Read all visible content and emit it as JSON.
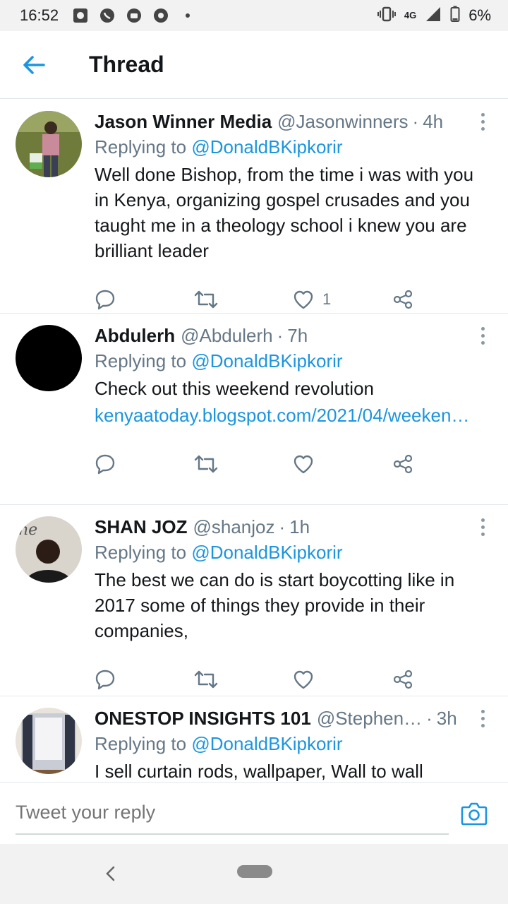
{
  "status_bar": {
    "time": "16:52",
    "network": "4G",
    "battery": "6%"
  },
  "header": {
    "title": "Thread"
  },
  "tweets": [
    {
      "name": "Jason Winner Media",
      "handle": "@Jasonwinners",
      "time": "4h",
      "replying_prefix": "Replying to ",
      "replying_to": "@DonaldBKipkorir",
      "text": "Well done Bishop, from the time i was with you in Kenya, organizing gospel crusades and you taught me in a theology school i knew you are brilliant leader",
      "link": "",
      "likes": "1"
    },
    {
      "name": "Abdulerh",
      "handle": "@Abdulerh",
      "time": "7h",
      "replying_prefix": "Replying to ",
      "replying_to": "@DonaldBKipkorir",
      "text": "Check out this weekend revolution",
      "link": "kenyaatoday.blogspot.com/2021/04/weeken…",
      "likes": ""
    },
    {
      "name": "SHAN JOZ",
      "handle": "@shanjoz",
      "time": "1h",
      "replying_prefix": "Replying to ",
      "replying_to": "@DonaldBKipkorir",
      "text": "The best we can do is start boycotting like in 2017 some of things they provide in their companies,",
      "link": "",
      "likes": ""
    },
    {
      "name": "ONESTOP INSIGHTS 101",
      "handle": "@Stephen…",
      "time": "3h",
      "replying_prefix": "Replying to ",
      "replying_to": "@DonaldBKipkorir",
      "text": "I sell curtain rods, wallpaper, Wall to wall",
      "link": "",
      "likes": ""
    }
  ],
  "reply_bar": {
    "placeholder": "Tweet your reply"
  },
  "colors": {
    "accent": "#1b95e0",
    "secondary_text": "#657786",
    "divider": "#e1e8ed"
  },
  "icons": [
    "back-arrow-icon",
    "reply-icon",
    "retweet-icon",
    "like-icon",
    "share-icon",
    "more-icon",
    "camera-icon"
  ]
}
